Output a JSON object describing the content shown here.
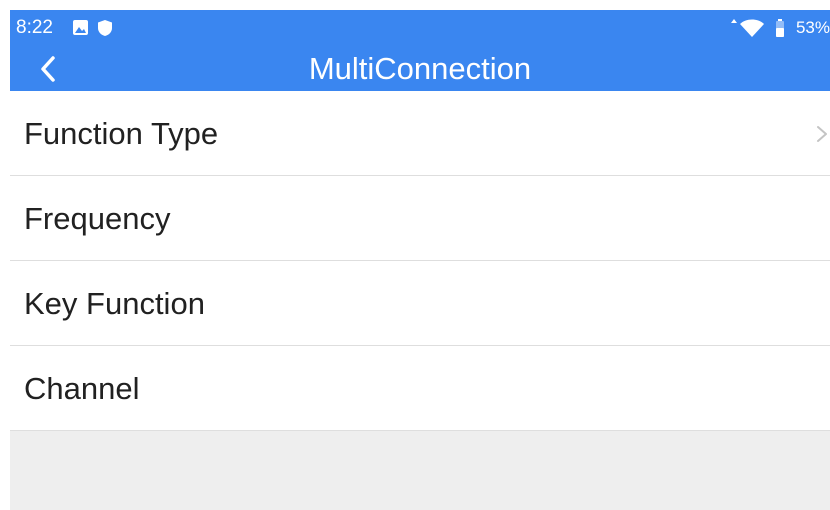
{
  "status_bar": {
    "time": "8:22",
    "left_icons": [
      "image-icon",
      "shield-icon"
    ],
    "right_icons": [
      "data-activity-icon",
      "wifi-icon",
      "battery-icon"
    ],
    "battery_text": "53%"
  },
  "header": {
    "title": "MultiConnection",
    "back_icon": "chevron-left-icon"
  },
  "menu": {
    "items": [
      {
        "label": "Function Type",
        "has_chevron": true
      },
      {
        "label": "Frequency",
        "has_chevron": false
      },
      {
        "label": "Key Function",
        "has_chevron": false
      },
      {
        "label": "Channel",
        "has_chevron": false
      }
    ]
  },
  "colors": {
    "header_background": "#3a86f0",
    "page_background": "#eeeeee",
    "list_background": "#ffffff",
    "divider": "#dedede",
    "text_primary": "#212121",
    "chevron": "#c4c4c4"
  }
}
